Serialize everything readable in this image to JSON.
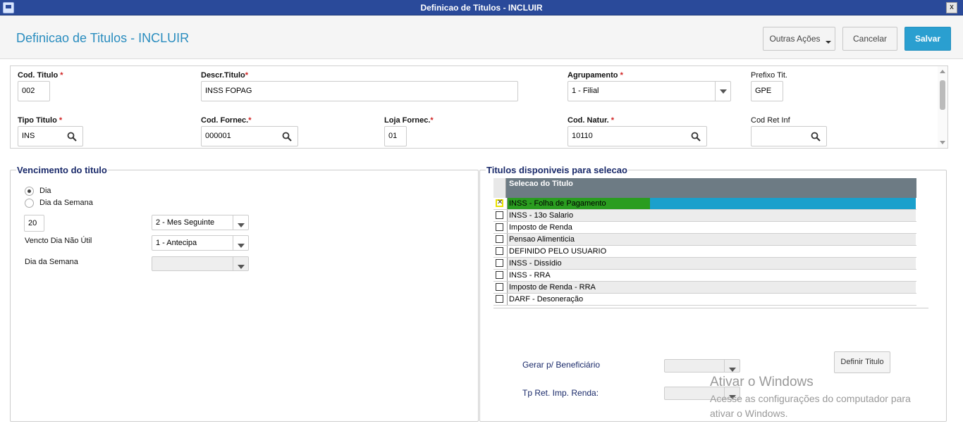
{
  "window": {
    "title": "Definicao de Titulos - INCLUIR",
    "close_label": "x"
  },
  "header": {
    "page_title": "Definicao de Titulos - INCLUIR",
    "outras_acoes": "Outras Ações",
    "cancelar": "Cancelar",
    "salvar": "Salvar"
  },
  "form": {
    "cod_titulo": {
      "label": "Cod. Titulo",
      "req": "*",
      "value": "002"
    },
    "descr_titulo": {
      "label": "Descr.Titulo",
      "req": "*",
      "value": "INSS FOPAG"
    },
    "agrupamento": {
      "label": "Agrupamento",
      "req": "*",
      "value": "1 - Filial"
    },
    "prefixo_tit": {
      "label": "Prefixo Tit.",
      "value": "GPE"
    },
    "tipo_titulo": {
      "label": "Tipo Titulo",
      "req": "*",
      "value": "INS"
    },
    "cod_fornec": {
      "label": "Cod. Fornec.",
      "req": "*",
      "value": "000001"
    },
    "loja_fornec": {
      "label": "Loja Fornec.",
      "req": "*",
      "value": "01"
    },
    "cod_natur": {
      "label": "Cod. Natur.",
      "req": "*",
      "value": "10110"
    },
    "cod_ret_inf": {
      "label": "Cod Ret Inf",
      "value": ""
    }
  },
  "vencimento": {
    "legend": "Vencimento do titulo",
    "radio_dia": "Dia",
    "radio_dia_semana": "Dia da Semana",
    "dia_value": "20",
    "mes_select": "2 - Mes Seguinte",
    "vencto_label": "Vencto Dia Não Útil",
    "vencto_select": "1 - Antecipa",
    "dia_semana_label": "Dia da Semana",
    "dia_semana_select": ""
  },
  "titulos": {
    "legend": "Titulos disponiveis para selecao",
    "column_header": "Selecao do Titulo",
    "rows": [
      "INSS - Folha de Pagamento",
      "INSS - 13o Salario",
      "Imposto de Renda",
      "Pensao Alimenticia",
      "DEFINIDO PELO USUARIO",
      "INSS - Dissídio",
      "INSS - RRA",
      "Imposto de Renda - RRA",
      "DARF - Desoneração"
    ],
    "gerar_label": "Gerar p/ Beneficiário",
    "tp_ret_label": "Tp Ret. Imp. Renda:",
    "definir_button": "Definir Titulo"
  },
  "watermark": {
    "line1": "Ativar o Windows",
    "line2": "Acesse as configurações do computador para ativar o Windows."
  }
}
